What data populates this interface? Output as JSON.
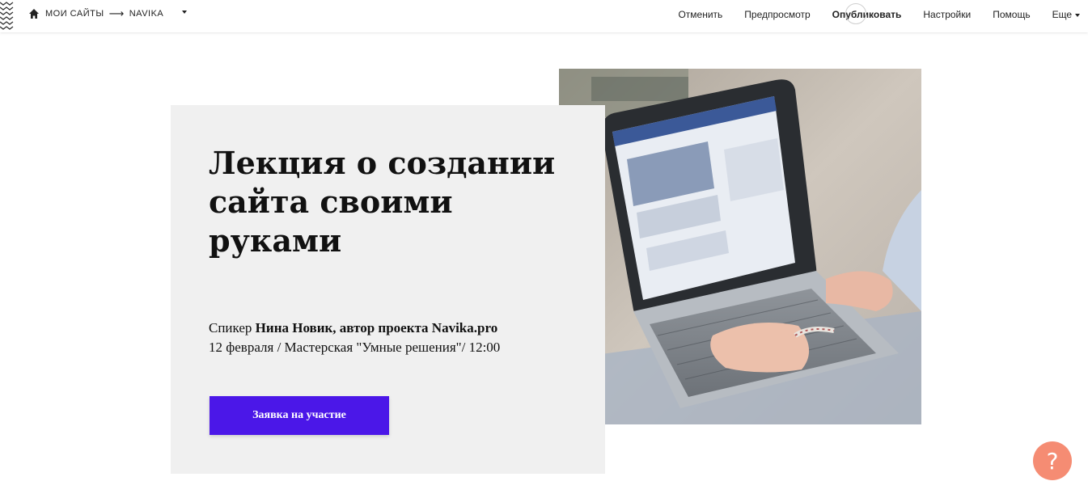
{
  "topbar": {
    "breadcrumb": [
      {
        "label": "Мои сайты"
      },
      {
        "label": "NAVIKA"
      }
    ],
    "menu": {
      "cancel": "Отменить",
      "preview": "Предпросмотр",
      "publish": "Опубликовать",
      "settings": "Настройки",
      "help": "Помощь",
      "more": "Еще"
    }
  },
  "hero": {
    "title": "Лекция о создании сайта своими руками",
    "speaker_prefix": "Спикер ",
    "speaker_name": "Нина Новик, автор проекта Navika.pro",
    "details": "12 февраля / Мастерская \"Умные решения\"/ 12:00",
    "cta_label": "Заявка на участие"
  },
  "help_button": {
    "label": "?"
  },
  "colors": {
    "accent": "#4b17e8",
    "card_bg": "#f0f0f0",
    "help_bg": "#f58c73"
  },
  "icons": [
    "home-icon",
    "zigzag-logo-icon",
    "chevron-down-icon",
    "question-icon"
  ]
}
